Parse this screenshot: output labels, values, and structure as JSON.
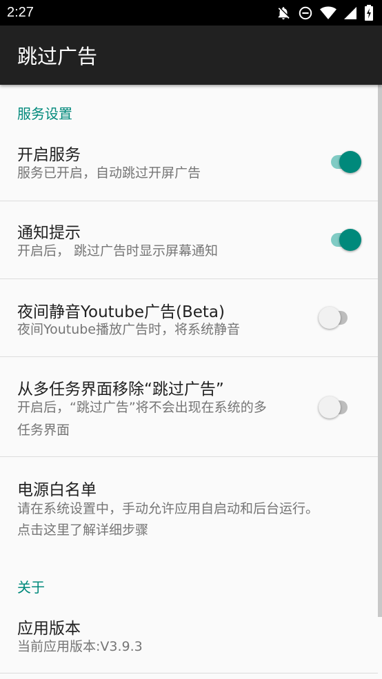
{
  "status_bar": {
    "time": "2:27",
    "icons": [
      "notifications-off-icon",
      "do-not-disturb-icon",
      "wifi-icon",
      "cell-signal-icon",
      "battery-icon"
    ]
  },
  "app_bar": {
    "title": "跳过广告"
  },
  "sections": {
    "service": {
      "header": "服务设置"
    },
    "about": {
      "header": "关于"
    }
  },
  "prefs": {
    "enable_service": {
      "title": "开启服务",
      "summary": "服务已开启，自动跳过开屏广告",
      "checked": true
    },
    "notify": {
      "title": "通知提示",
      "summary": "开启后， 跳过广告时显示屏幕通知",
      "checked": true
    },
    "night_mute": {
      "title": "夜间静音Youtube广告(Beta)",
      "summary": "夜间Youtube播放广告时，将系统静音",
      "checked": false
    },
    "hide_recents": {
      "title": "从多任务界面移除“跳过广告”",
      "summary_line1": "开启后，“跳过广告”将不会出现在系统的多",
      "summary_line2": "任务界面",
      "checked": false
    },
    "whitelist": {
      "title": "电源白名单",
      "summary_line1": "请在系统设置中，手动允许应用自启动和后台运行。",
      "summary_line2": "点击这里了解详细步骤"
    },
    "version": {
      "title": "应用版本",
      "summary": "当前应用版本:V3.9.3"
    }
  },
  "colors": {
    "accent": "#00897b",
    "app_bar": "#212121",
    "status_bar": "#000000",
    "background": "#fafafa"
  }
}
